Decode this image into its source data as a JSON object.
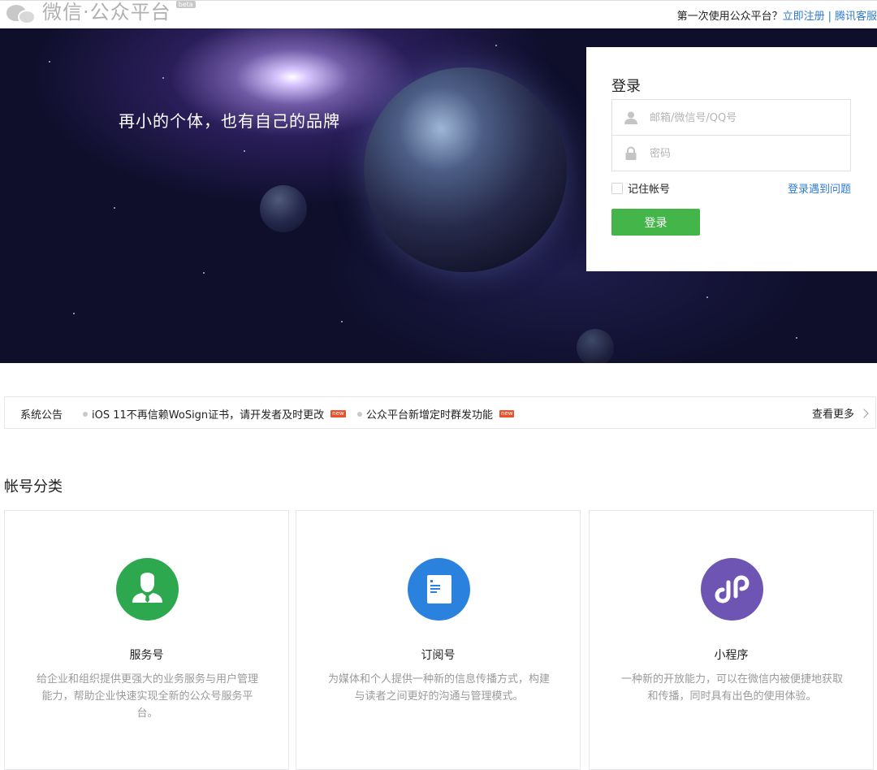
{
  "header": {
    "logo_title": "微信·公众平台",
    "beta_badge": "beta",
    "first_time_text": "第一次使用公众平台？",
    "register_link": "立即注册",
    "separator": "|",
    "support_link": "腾讯客服"
  },
  "banner": {
    "slogan": "再小的个体，也有自己的品牌"
  },
  "login": {
    "title": "登录",
    "account_placeholder": "邮箱/微信号/QQ号",
    "password_placeholder": "密码",
    "remember_label": "记住帐号",
    "forgot_link": "登录遇到问题",
    "submit_label": "登录"
  },
  "notice": {
    "label": "系统公告",
    "items": [
      {
        "text": "iOS 11不再信赖WoSign证书，请开发者及时更改",
        "tag": "new"
      },
      {
        "text": "公众平台新增定时群发功能",
        "tag": "new"
      }
    ],
    "more_label": "查看更多"
  },
  "account_types": {
    "title": "帐号分类",
    "cards": [
      {
        "name": "服务号",
        "desc": "给企业和组织提供更强大的业务服务与用户管理能力，帮助企业快速实现全新的公众号服务平台。",
        "color": "#2ea84f",
        "icon": "person-tie-icon"
      },
      {
        "name": "订阅号",
        "desc": "为媒体和个人提供一种新的信息传播方式，构建与读者之间更好的沟通与管理模式。",
        "color": "#2a82de",
        "icon": "document-icon"
      },
      {
        "name": "小程序",
        "desc": "一种新的开放能力，可以在微信内被便捷地获取和传播，同时具有出色的使用体验。",
        "color": "#6f55b3",
        "icon": "mini-program-icon"
      }
    ]
  },
  "colors": {
    "accent_green": "#44b549",
    "link_blue": "#2e7ad1"
  }
}
